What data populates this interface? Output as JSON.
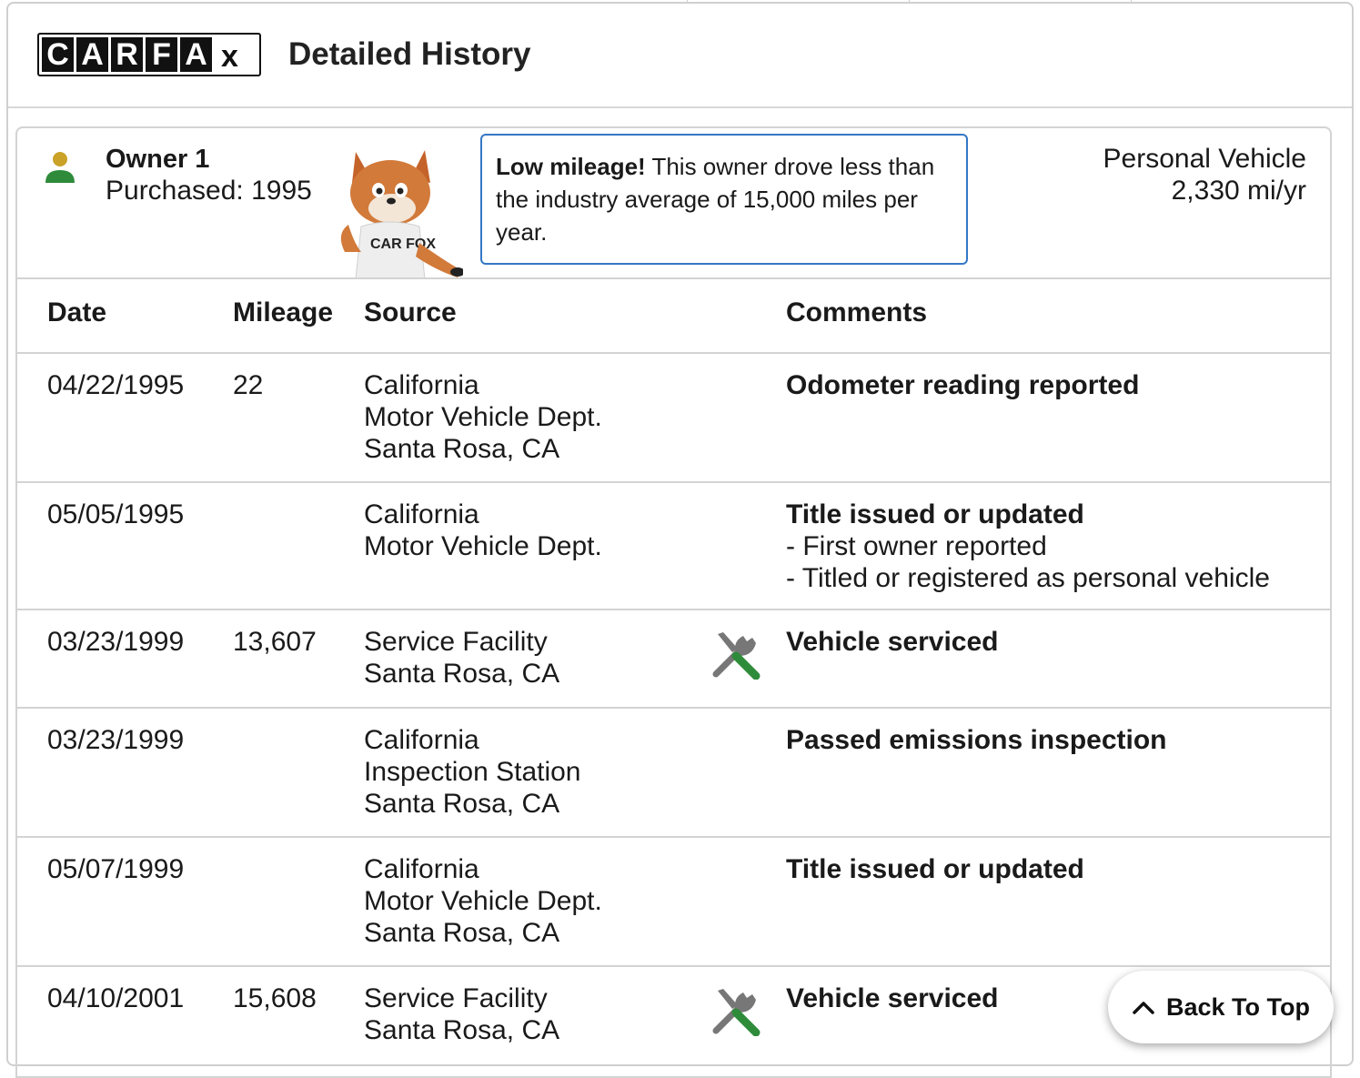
{
  "header": {
    "logo_letters": [
      "C",
      "A",
      "R",
      "F",
      "A"
    ],
    "logo_x": "x",
    "title": "Detailed History"
  },
  "owner": {
    "name": "Owner 1",
    "purchased": "Purchased: 1995",
    "mascot_shirt_text": "CAR FOX",
    "callout_bold": "Low mileage!",
    "callout_text": " This owner drove less than the industry average of 15,000 miles per year.",
    "vehicle_type": "Personal Vehicle",
    "mileage_rate": "2,330 mi/yr"
  },
  "table": {
    "columns": [
      "Date",
      "Mileage",
      "Source",
      "Comments"
    ],
    "rows": [
      {
        "date": "04/22/1995",
        "mileage": "22",
        "source": [
          "California",
          "Motor Vehicle Dept.",
          "Santa Rosa, CA"
        ],
        "icon": "",
        "comment_title": "Odometer reading reported",
        "comment_items": []
      },
      {
        "date": "05/05/1995",
        "mileage": "",
        "source": [
          "California",
          "Motor Vehicle Dept."
        ],
        "icon": "",
        "comment_title": "Title issued or updated",
        "comment_items": [
          "First owner reported",
          "Titled or registered as personal vehicle"
        ]
      },
      {
        "date": "03/23/1999",
        "mileage": "13,607",
        "source": [
          "Service Facility",
          "Santa Rosa, CA"
        ],
        "icon": "service-wrench-screwdriver-icon",
        "comment_title": "Vehicle serviced",
        "comment_items": []
      },
      {
        "date": "03/23/1999",
        "mileage": "",
        "source": [
          "California",
          "Inspection Station",
          "Santa Rosa, CA"
        ],
        "icon": "",
        "comment_title": "Passed emissions inspection",
        "comment_items": []
      },
      {
        "date": "05/07/1999",
        "mileage": "",
        "source": [
          "California",
          "Motor Vehicle Dept.",
          "Santa Rosa, CA"
        ],
        "icon": "",
        "comment_title": "Title issued or updated",
        "comment_items": []
      },
      {
        "date": "04/10/2001",
        "mileage": "15,608",
        "source": [
          "Service Facility",
          "Santa Rosa, CA"
        ],
        "icon": "service-wrench-screwdriver-icon",
        "comment_title": "Vehicle serviced",
        "comment_items": []
      }
    ]
  },
  "back_to_top": {
    "label": "Back To Top",
    "icon": "chevron-up-icon"
  },
  "colors": {
    "callout_border": "#3477c5",
    "icon_green": "#2e8b3a",
    "icon_gold": "#c9a227",
    "tool_gray": "#777777"
  }
}
